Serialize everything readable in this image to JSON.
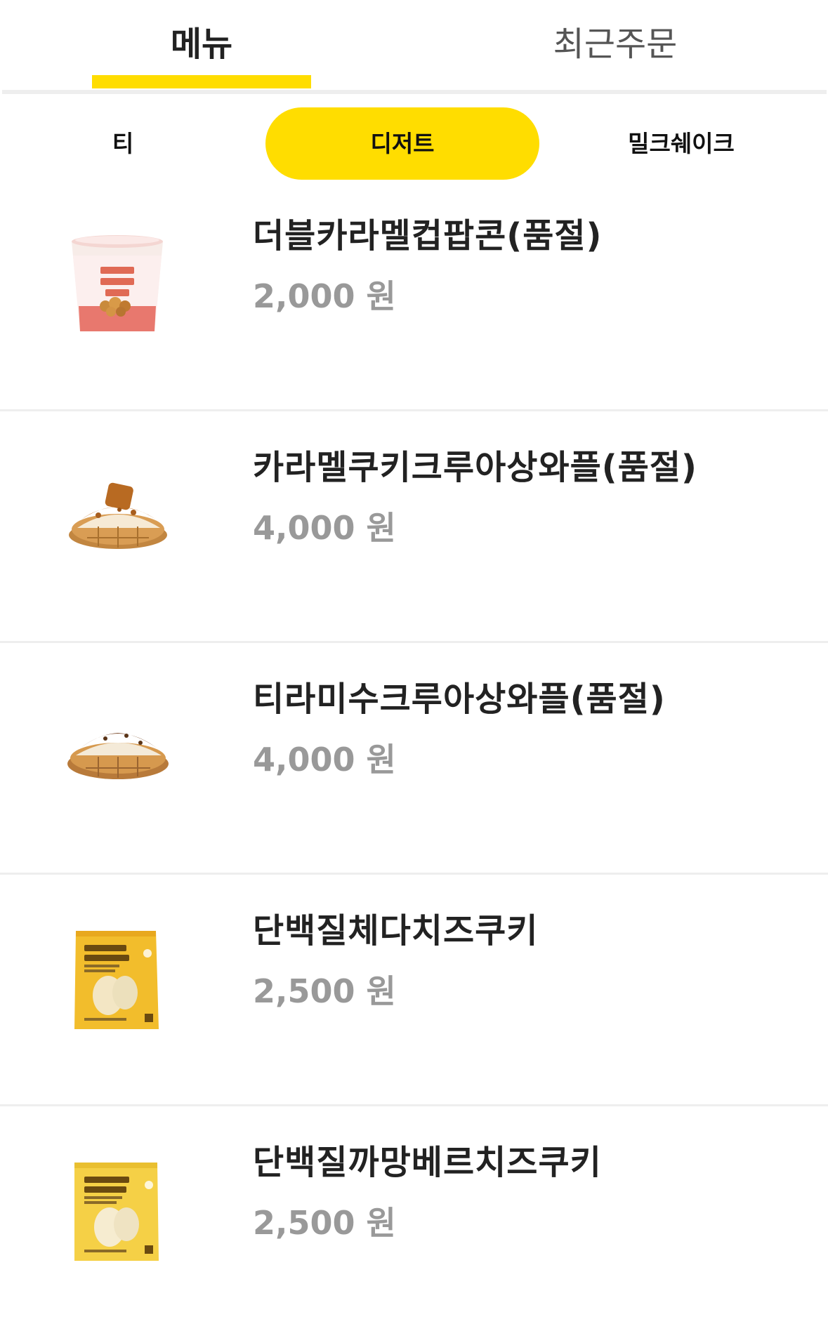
{
  "top_tabs": [
    {
      "label": "메뉴",
      "active": true
    },
    {
      "label": "최근주문",
      "active": false
    }
  ],
  "categories": [
    {
      "label": "티",
      "active": false
    },
    {
      "label": "디저트",
      "active": true
    },
    {
      "label": "밀크쉐이크",
      "active": false
    }
  ],
  "items": [
    {
      "name": "더블카라멜컵팝콘(품절)",
      "price": "2,000 원",
      "image": "caramel-popcorn-cup-image"
    },
    {
      "name": "카라멜쿠키크루아상와플(품절)",
      "price": "4,000 원",
      "image": "caramel-cookie-croissant-waffle-image"
    },
    {
      "name": "티라미수크루아상와플(품절)",
      "price": "4,000 원",
      "image": "tiramisu-croissant-waffle-image"
    },
    {
      "name": "단백질체다치즈쿠키",
      "price": "2,500 원",
      "image": "cheddar-protein-cookie-image"
    },
    {
      "name": "단백질까망베르치즈쿠키",
      "price": "2,500 원",
      "image": "camembert-protein-cookie-image"
    }
  ],
  "colors": {
    "accent": "#ffdd00",
    "divider": "#eeeeee",
    "price": "#999999"
  }
}
